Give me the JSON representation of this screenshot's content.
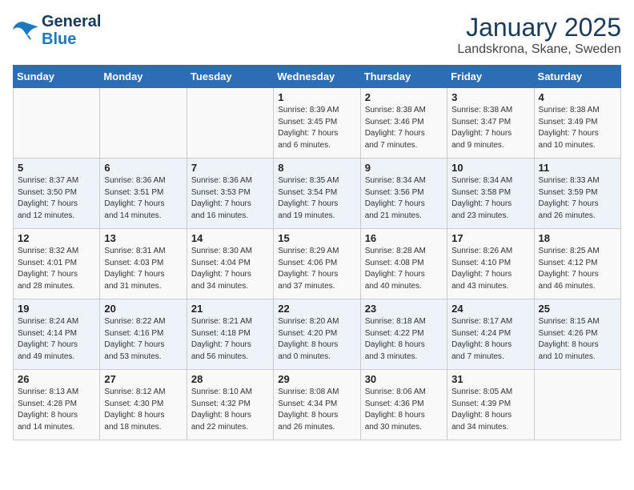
{
  "logo": {
    "line1": "General",
    "line2": "Blue"
  },
  "title": "January 2025",
  "subtitle": "Landskrona, Skane, Sweden",
  "headers": [
    "Sunday",
    "Monday",
    "Tuesday",
    "Wednesday",
    "Thursday",
    "Friday",
    "Saturday"
  ],
  "weeks": [
    [
      {
        "day": "",
        "info": ""
      },
      {
        "day": "",
        "info": ""
      },
      {
        "day": "",
        "info": ""
      },
      {
        "day": "1",
        "info": "Sunrise: 8:39 AM\nSunset: 3:45 PM\nDaylight: 7 hours\nand 6 minutes."
      },
      {
        "day": "2",
        "info": "Sunrise: 8:38 AM\nSunset: 3:46 PM\nDaylight: 7 hours\nand 7 minutes."
      },
      {
        "day": "3",
        "info": "Sunrise: 8:38 AM\nSunset: 3:47 PM\nDaylight: 7 hours\nand 9 minutes."
      },
      {
        "day": "4",
        "info": "Sunrise: 8:38 AM\nSunset: 3:49 PM\nDaylight: 7 hours\nand 10 minutes."
      }
    ],
    [
      {
        "day": "5",
        "info": "Sunrise: 8:37 AM\nSunset: 3:50 PM\nDaylight: 7 hours\nand 12 minutes."
      },
      {
        "day": "6",
        "info": "Sunrise: 8:36 AM\nSunset: 3:51 PM\nDaylight: 7 hours\nand 14 minutes."
      },
      {
        "day": "7",
        "info": "Sunrise: 8:36 AM\nSunset: 3:53 PM\nDaylight: 7 hours\nand 16 minutes."
      },
      {
        "day": "8",
        "info": "Sunrise: 8:35 AM\nSunset: 3:54 PM\nDaylight: 7 hours\nand 19 minutes."
      },
      {
        "day": "9",
        "info": "Sunrise: 8:34 AM\nSunset: 3:56 PM\nDaylight: 7 hours\nand 21 minutes."
      },
      {
        "day": "10",
        "info": "Sunrise: 8:34 AM\nSunset: 3:58 PM\nDaylight: 7 hours\nand 23 minutes."
      },
      {
        "day": "11",
        "info": "Sunrise: 8:33 AM\nSunset: 3:59 PM\nDaylight: 7 hours\nand 26 minutes."
      }
    ],
    [
      {
        "day": "12",
        "info": "Sunrise: 8:32 AM\nSunset: 4:01 PM\nDaylight: 7 hours\nand 28 minutes."
      },
      {
        "day": "13",
        "info": "Sunrise: 8:31 AM\nSunset: 4:03 PM\nDaylight: 7 hours\nand 31 minutes."
      },
      {
        "day": "14",
        "info": "Sunrise: 8:30 AM\nSunset: 4:04 PM\nDaylight: 7 hours\nand 34 minutes."
      },
      {
        "day": "15",
        "info": "Sunrise: 8:29 AM\nSunset: 4:06 PM\nDaylight: 7 hours\nand 37 minutes."
      },
      {
        "day": "16",
        "info": "Sunrise: 8:28 AM\nSunset: 4:08 PM\nDaylight: 7 hours\nand 40 minutes."
      },
      {
        "day": "17",
        "info": "Sunrise: 8:26 AM\nSunset: 4:10 PM\nDaylight: 7 hours\nand 43 minutes."
      },
      {
        "day": "18",
        "info": "Sunrise: 8:25 AM\nSunset: 4:12 PM\nDaylight: 7 hours\nand 46 minutes."
      }
    ],
    [
      {
        "day": "19",
        "info": "Sunrise: 8:24 AM\nSunset: 4:14 PM\nDaylight: 7 hours\nand 49 minutes."
      },
      {
        "day": "20",
        "info": "Sunrise: 8:22 AM\nSunset: 4:16 PM\nDaylight: 7 hours\nand 53 minutes."
      },
      {
        "day": "21",
        "info": "Sunrise: 8:21 AM\nSunset: 4:18 PM\nDaylight: 7 hours\nand 56 minutes."
      },
      {
        "day": "22",
        "info": "Sunrise: 8:20 AM\nSunset: 4:20 PM\nDaylight: 8 hours\nand 0 minutes."
      },
      {
        "day": "23",
        "info": "Sunrise: 8:18 AM\nSunset: 4:22 PM\nDaylight: 8 hours\nand 3 minutes."
      },
      {
        "day": "24",
        "info": "Sunrise: 8:17 AM\nSunset: 4:24 PM\nDaylight: 8 hours\nand 7 minutes."
      },
      {
        "day": "25",
        "info": "Sunrise: 8:15 AM\nSunset: 4:26 PM\nDaylight: 8 hours\nand 10 minutes."
      }
    ],
    [
      {
        "day": "26",
        "info": "Sunrise: 8:13 AM\nSunset: 4:28 PM\nDaylight: 8 hours\nand 14 minutes."
      },
      {
        "day": "27",
        "info": "Sunrise: 8:12 AM\nSunset: 4:30 PM\nDaylight: 8 hours\nand 18 minutes."
      },
      {
        "day": "28",
        "info": "Sunrise: 8:10 AM\nSunset: 4:32 PM\nDaylight: 8 hours\nand 22 minutes."
      },
      {
        "day": "29",
        "info": "Sunrise: 8:08 AM\nSunset: 4:34 PM\nDaylight: 8 hours\nand 26 minutes."
      },
      {
        "day": "30",
        "info": "Sunrise: 8:06 AM\nSunset: 4:36 PM\nDaylight: 8 hours\nand 30 minutes."
      },
      {
        "day": "31",
        "info": "Sunrise: 8:05 AM\nSunset: 4:39 PM\nDaylight: 8 hours\nand 34 minutes."
      },
      {
        "day": "",
        "info": ""
      }
    ]
  ]
}
